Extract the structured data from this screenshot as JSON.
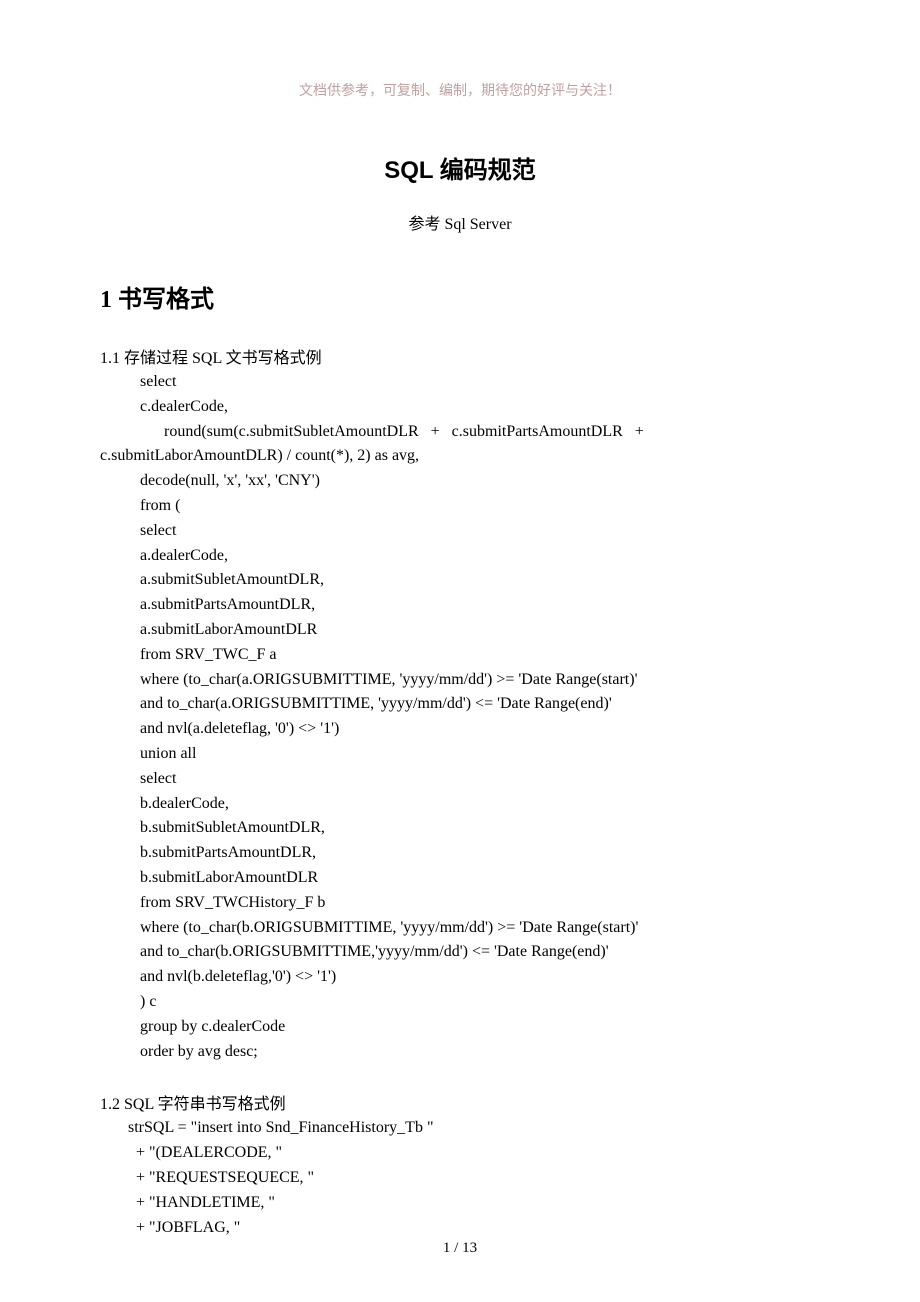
{
  "header_note": "文档供参考，可复制、编制，期待您的好评与关注！",
  "title": "SQL 编码规范",
  "subtitle": "参考 Sql Server",
  "section1": {
    "heading": "1 书写格式",
    "sub1": {
      "heading": "1.1  存储过程 SQL 文书写格式例",
      "lines": [
        "select",
        "c.dealerCode,",
        "      round(sum(c.submitSubletAmountDLR   +   c.submitPartsAmountDLR   +",
        "c.submitLaborAmountDLR) / count(*), 2) as avg,",
        "decode(null, 'x', 'xx', 'CNY')",
        "from (",
        "select",
        "a.dealerCode,",
        "a.submitSubletAmountDLR,",
        "a.submitPartsAmountDLR,",
        "a.submitLaborAmountDLR",
        "from SRV_TWC_F a",
        "where (to_char(a.ORIGSUBMITTIME, 'yyyy/mm/dd') >= 'Date Range(start)'",
        "and to_char(a.ORIGSUBMITTIME, 'yyyy/mm/dd') <= 'Date Range(end)'",
        "and nvl(a.deleteflag, '0') <> '1')",
        "union all",
        "select",
        "b.dealerCode,",
        "b.submitSubletAmountDLR,",
        "b.submitPartsAmountDLR,",
        "b.submitLaborAmountDLR",
        "from SRV_TWCHistory_F b",
        "where (to_char(b.ORIGSUBMITTIME, 'yyyy/mm/dd') >= 'Date Range(start)'",
        "and to_char(b.ORIGSUBMITTIME,'yyyy/mm/dd') <= 'Date Range(end)'",
        "and nvl(b.deleteflag,'0') <> '1')",
        ") c",
        "group by c.dealerCode",
        "order by avg desc;"
      ]
    },
    "sub2": {
      "heading": "1.2    SQL 字符串书写格式例",
      "lines": [
        "strSQL = \"insert into Snd_FinanceHistory_Tb \"",
        "  + \"(DEALERCODE, \"",
        "  + \"REQUESTSEQUECE, \"",
        "  + \"HANDLETIME, \"",
        "  + \"JOBFLAG, \""
      ]
    }
  },
  "page_number": "1  / 13"
}
